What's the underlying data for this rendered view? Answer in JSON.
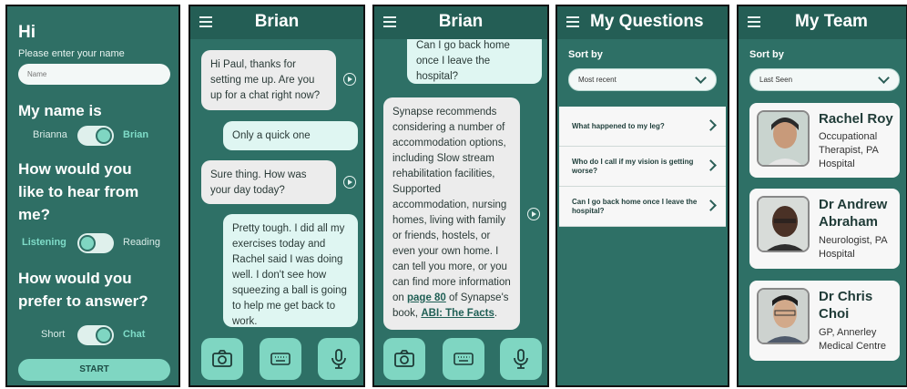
{
  "screen1": {
    "greeting": "Hi",
    "prompt": "Please enter your name",
    "name_placeholder": "Name",
    "my_name_heading": "My name is",
    "name_toggle": {
      "left": "Brianna",
      "right": "Brian"
    },
    "hear_heading_1": "How would you",
    "hear_heading_2": "like to hear from",
    "hear_heading_3": "me?",
    "hear_toggle": {
      "left": "Listening",
      "right": "Reading"
    },
    "answer_heading_1": "How would you",
    "answer_heading_2": "prefer to answer?",
    "answer_toggle": {
      "left": "Short",
      "right": "Chat"
    },
    "start_label": "START"
  },
  "screen2": {
    "title": "Brian",
    "messages": [
      {
        "from": "bot",
        "text": "Hi Paul, thanks for setting me up. Are you up for a chat right now?"
      },
      {
        "from": "user",
        "text": "Only a quick one"
      },
      {
        "from": "bot",
        "text": "Sure thing. How was your day today?"
      },
      {
        "from": "user",
        "text": "Pretty tough. I did all my exercises today and Rachel said I was doing well. I don't see how squeezing a ball is going to help me get back to work."
      }
    ]
  },
  "screen3": {
    "title": "Brian",
    "user_msg": "Can I go back home once I leave the hospital?",
    "bot_msg_part1": "Synapse recommends considering a number of accommodation options, including Slow stream rehabilitation facilities, Supported accommodation, nursing homes, living with family or friends, hostels, or even your own home. I can tell you more, or you can find more information on ",
    "link_page": "page 80",
    "bot_msg_part2": " of Synapse's book, ",
    "link_book": "ABI: The Facts",
    "bot_msg_part3": "."
  },
  "screen4": {
    "title": "My Questions",
    "sort_label": "Sort by",
    "sort_value": "Most recent",
    "questions": [
      "What happened to my leg?",
      "Who do I call if my vision is getting worse?",
      "Can I go back home once I leave the hospital?"
    ]
  },
  "screen5": {
    "title": "My Team",
    "sort_label": "Sort by",
    "sort_value": "Last Seen",
    "members": [
      {
        "name": "Rachel Roy",
        "role": "Occupational Therapist, PA Hospital"
      },
      {
        "name": "Dr Andrew Abraham",
        "role": "Neurologist, PA Hospital"
      },
      {
        "name": "Dr Chris Choi",
        "role": "GP, Annerley Medical Centre"
      }
    ]
  },
  "colors": {
    "primary": "#2e7066",
    "accent": "#7fd6c2",
    "topbar": "#245e55"
  },
  "icons": [
    "menu-icon",
    "camera-icon",
    "keyboard-icon",
    "microphone-icon",
    "play-icon",
    "chevron-down-icon",
    "chevron-right-icon"
  ]
}
